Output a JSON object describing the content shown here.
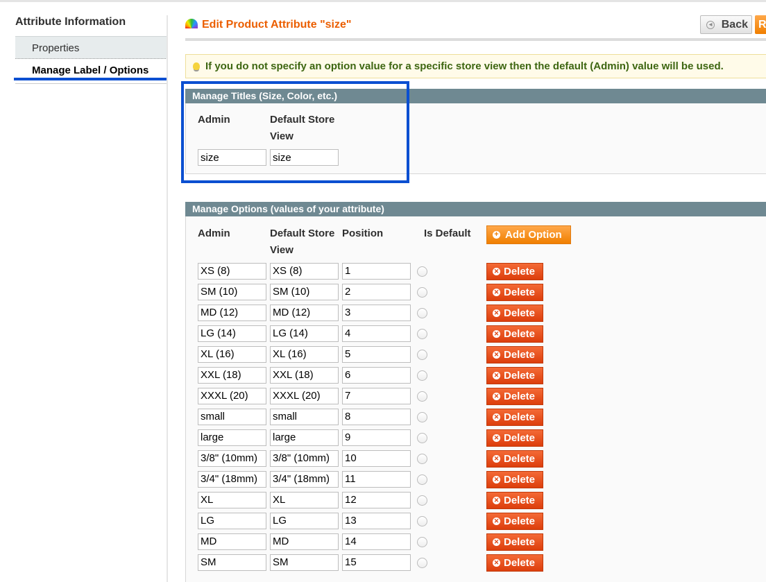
{
  "sidebar": {
    "title": "Attribute Information",
    "items": [
      {
        "label": "Properties",
        "active": false
      },
      {
        "label": "Manage Label / Options",
        "active": true
      }
    ]
  },
  "header": {
    "title": "Edit Product Attribute \"size\"",
    "back_label": "Back",
    "reset_label": "R",
    "title_icon": "rainbow-icon"
  },
  "notice": {
    "text": "If you do not specify an option value for a specific store view then the default (Admin) value will be used.",
    "icon": "lightbulb-icon"
  },
  "titles": {
    "heading": "Manage Titles (Size, Color, etc.)",
    "col_admin": "Admin",
    "col_store": "Default Store View",
    "admin_value": "size",
    "store_value": "size"
  },
  "options": {
    "heading": "Manage Options (values of your attribute)",
    "col_admin": "Admin",
    "col_store": "Default Store View",
    "col_position": "Position",
    "col_default": "Is Default",
    "add_label": "Add Option",
    "delete_label": "Delete",
    "rows": [
      {
        "admin": "XS (8)",
        "store": "XS (8)",
        "position": "1"
      },
      {
        "admin": "SM (10)",
        "store": "SM (10)",
        "position": "2"
      },
      {
        "admin": "MD (12)",
        "store": "MD (12)",
        "position": "3"
      },
      {
        "admin": "LG (14)",
        "store": "LG (14)",
        "position": "4"
      },
      {
        "admin": "XL (16)",
        "store": "XL (16)",
        "position": "5"
      },
      {
        "admin": "XXL (18)",
        "store": "XXL (18)",
        "position": "6"
      },
      {
        "admin": "XXXL (20)",
        "store": "XXXL (20)",
        "position": "7"
      },
      {
        "admin": "small",
        "store": "small",
        "position": "8"
      },
      {
        "admin": "large",
        "store": "large",
        "position": "9"
      },
      {
        "admin": "3/8\" (10mm)",
        "store": "3/8\" (10mm)",
        "position": "10"
      },
      {
        "admin": "3/4\" (18mm)",
        "store": "3/4\" (18mm)",
        "position": "11"
      },
      {
        "admin": "XL",
        "store": "XL",
        "position": "12"
      },
      {
        "admin": "LG",
        "store": "LG",
        "position": "13"
      },
      {
        "admin": "MD",
        "store": "MD",
        "position": "14"
      },
      {
        "admin": "SM",
        "store": "SM",
        "position": "15"
      }
    ]
  },
  "colors": {
    "accent": "#eb5e00",
    "section_header": "#6f8992",
    "highlight": "#0b4fd1",
    "delete": "#e04511"
  }
}
